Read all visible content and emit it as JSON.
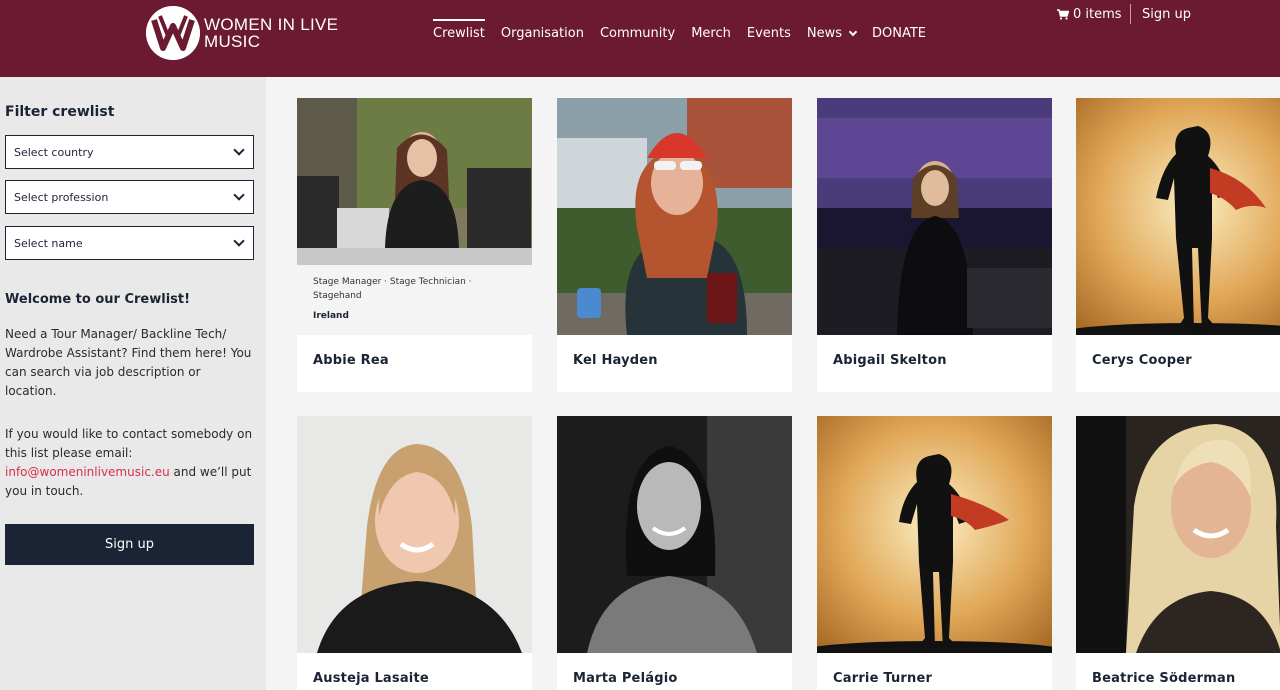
{
  "brand": {
    "line1": "WOMEN IN LIVE",
    "line2": "MUSIC"
  },
  "nav": [
    {
      "label": "Crewlist",
      "active": true
    },
    {
      "label": "Organisation"
    },
    {
      "label": "Community"
    },
    {
      "label": "Merch"
    },
    {
      "label": "Events"
    },
    {
      "label": "News"
    },
    {
      "label": "DONATE"
    }
  ],
  "cart": {
    "label": "0 items"
  },
  "account": {
    "signup_label": "Sign up"
  },
  "sidebar": {
    "title": "Filter crewlist",
    "selects": [
      "Select country",
      "Select profession",
      "Select name"
    ],
    "welcome": "Welcome to our Crewlist!",
    "para1": "Need a Tour Manager/ Backline Tech/ Wardrobe Assistant? Find them here! You can search via job description or location.",
    "para2_before": "If you would like to contact somebody on this list please email: ",
    "email": "info@womeninlivemusic.eu",
    "para2_after": " and we’ll put you in touch.",
    "signup_button": "Sign up"
  },
  "crew": [
    {
      "name": "Abbie Rea",
      "roles": "Stage Manager · Stage Technician · Stagehand",
      "country": "Ireland"
    },
    {
      "name": "Kel Hayden"
    },
    {
      "name": "Abigail Skelton"
    },
    {
      "name": "Cerys Cooper"
    },
    {
      "name": "Austeja Lasaite"
    },
    {
      "name": "Marta Pelágio"
    },
    {
      "name": "Carrie Turner"
    },
    {
      "name": "Beatrice Söderman"
    }
  ],
  "colors": {
    "brand": "#6b1a32",
    "navy": "#1b2434",
    "link": "#d6314a"
  }
}
